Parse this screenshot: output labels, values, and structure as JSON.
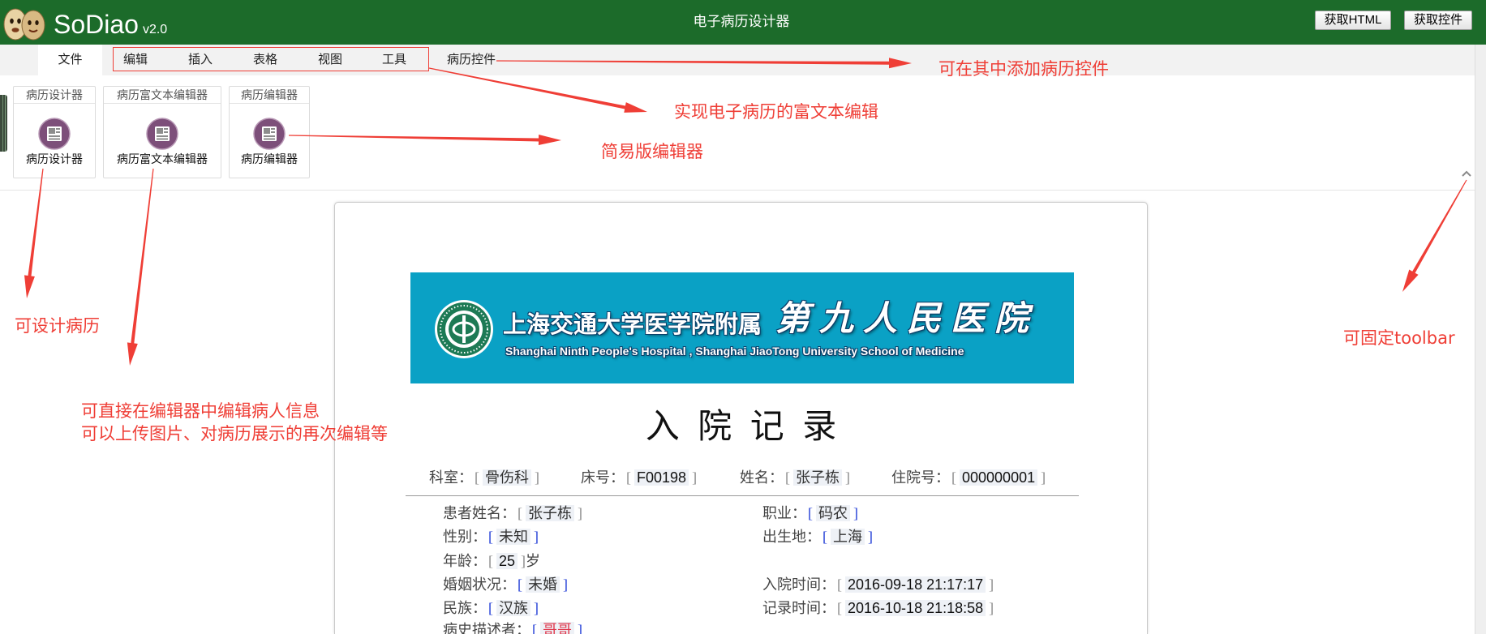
{
  "colors": {
    "header_bg": "#1c6b2a",
    "annotation_red": "#ef3e36",
    "banner_bg": "#0aa1c5",
    "bracket_gray": "#8a8a8a",
    "bracket_blue": "#1f3bd6",
    "value_red": "#e0364a"
  },
  "header": {
    "logo_icon": "egg-faces-icon",
    "logo_text": "SoDiao",
    "version": "v2.0",
    "title": "电子病历设计器",
    "buttons": [
      {
        "label": "获取HTML"
      },
      {
        "label": "获取控件"
      }
    ]
  },
  "tabs": [
    {
      "label": "文件",
      "active": true
    },
    {
      "label": "编辑"
    },
    {
      "label": "插入"
    },
    {
      "label": "表格"
    },
    {
      "label": "视图"
    },
    {
      "label": "工具"
    },
    {
      "label": "病历控件"
    }
  ],
  "ribbon": {
    "pin_icon": "chevron-up-icon",
    "groups": [
      {
        "header": "病历设计器",
        "button_label": "病历设计器",
        "icon": "document-icon"
      },
      {
        "header": "病历富文本编辑器",
        "button_label": "病历富文本编辑器",
        "icon": "document-icon"
      },
      {
        "header": "病历编辑器",
        "button_label": "病历编辑器",
        "icon": "document-icon"
      }
    ]
  },
  "document": {
    "banner": {
      "emblem_icon": "hospital-emblem-icon",
      "cn_text": "上海交通大学医学院附属",
      "cn_name": "第九人民医院",
      "en_text": "Shanghai Ninth People's Hospital , Shanghai JiaoTong University School of Medicine"
    },
    "title": "入 院 记 录",
    "brackets": {
      "open": "[",
      "close": "]"
    },
    "info_row": [
      {
        "label": "科室：",
        "value": "骨伤科"
      },
      {
        "label": "床号：",
        "value": "F00198"
      },
      {
        "label": "姓名：",
        "value": "张子栋"
      },
      {
        "label": "住院号：",
        "value": "000000001"
      }
    ],
    "fields": [
      {
        "label": "患者姓名：",
        "value": "张子栋",
        "bracket_color": "#8a8a8a"
      },
      {
        "label": "职业：",
        "value": "码农",
        "bracket_color": "#1f3bd6"
      },
      {
        "label": "性别：",
        "value": "未知",
        "bracket_color": "#1f3bd6"
      },
      {
        "label": "出生地：",
        "value": "上海",
        "bracket_color": "#1f3bd6"
      },
      {
        "label": "年龄：",
        "value": "25",
        "suffix": "岁",
        "bracket_color": "#8a8a8a"
      },
      {
        "label": "婚姻状况：",
        "value": "未婚",
        "bracket_color": "#1f3bd6"
      },
      {
        "label": "入院时间：",
        "value": "2016-09-18 21:17:17",
        "bracket_color": "#8a8a8a"
      },
      {
        "label": "民族：",
        "value": "汉族",
        "bracket_color": "#1f3bd6"
      },
      {
        "label": "记录时间：",
        "value": "2016-10-18 21:18:58",
        "bracket_color": "#8a8a8a"
      },
      {
        "label": "病史描述者：",
        "value": "哥哥",
        "bracket_color": "#1f3bd6",
        "value_color": "#e0364a"
      }
    ]
  },
  "annotations": [
    {
      "text": "可在其中添加病历控件"
    },
    {
      "text": "实现电子病历的富文本编辑"
    },
    {
      "text": "简易版编辑器"
    },
    {
      "text": "可设计病历"
    },
    {
      "text": "可直接在编辑器中编辑病人信息"
    },
    {
      "text": "可以上传图片、对病历展示的再次编辑等"
    },
    {
      "text": "可固定toolbar"
    }
  ]
}
